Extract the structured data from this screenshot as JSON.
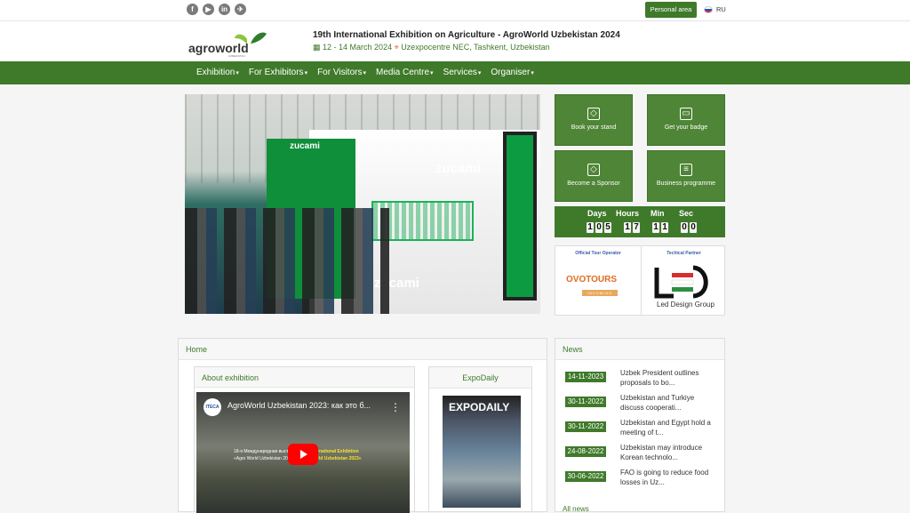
{
  "topbar": {
    "social_icons": [
      "facebook-icon",
      "youtube-icon",
      "linkedin-icon",
      "telegram-icon"
    ],
    "personal_area": "Personal area",
    "language": "RU"
  },
  "logo": {
    "text": "agroworld",
    "sub": "UZBEKISTAN"
  },
  "header": {
    "title": "19th International Exhibition on Agriculture - AgroWorld Uzbekistan 2024",
    "dates": "12 - 14 March 2024",
    "venue": "Uzexpocentre NEC, Tashkent, Uzbekistan"
  },
  "nav": [
    "Exhibition",
    "For Exhibitors",
    "For Visitors",
    "Media Centre",
    "Services",
    "Organiser"
  ],
  "hero": {
    "brand": "zucami",
    "brand_sub": "POULTRY EQUIPMENT"
  },
  "tiles": [
    {
      "label": "Book your stand",
      "icon": "stand-icon"
    },
    {
      "label": "Get your badge",
      "icon": "badge-icon"
    },
    {
      "label": "Become a Sponsor",
      "icon": "sponsor-icon"
    },
    {
      "label": "Business programme",
      "icon": "programme-icon"
    }
  ],
  "countdown": {
    "labels": [
      "Days",
      "Hours",
      "Min",
      "Sec"
    ],
    "days": [
      "1",
      "0",
      "5"
    ],
    "hours": [
      "1",
      "7"
    ],
    "minutes": [
      "1",
      "1"
    ],
    "seconds": [
      "0",
      "0"
    ]
  },
  "partners": [
    {
      "title": "Official Tour Operator",
      "name": "OVOTOURS",
      "sub": "SILK ROAD",
      "tagline": "INCOMING"
    },
    {
      "title": "Techical Partner",
      "name": "Led Design Group",
      "colors": [
        "#d62d2d",
        "#ffffff",
        "#2d8f3e"
      ]
    }
  ],
  "home": {
    "heading": "Home",
    "about": {
      "heading": "About exhibition",
      "video_title": "AgroWorld Uzbekistan 2023: как это б...",
      "caption_left": "18-я Международная выставка",
      "caption_left_2": "«Agro World Uzbekistan 2023»",
      "caption_right": "18th International Exhibition",
      "caption_right_2": "«Agro World Uzbekistan 2023»",
      "channel": "ITECA"
    },
    "expo": {
      "heading": "ExpoDaily",
      "magazine": "EXPODAILY"
    }
  },
  "news": {
    "heading": "News",
    "items": [
      {
        "date": "14-11-2023",
        "text": "Uzbek President outlines proposals to bo..."
      },
      {
        "date": "30-11-2022",
        "text": "Uzbekistan and Turkiye discuss cooperati..."
      },
      {
        "date": "30-11-2022",
        "text": "Uzbekistan and Egypt hold a meeting of t..."
      },
      {
        "date": "24-08-2022",
        "text": "Uzbekistan may introduce Korean technolo..."
      },
      {
        "date": "30-06-2022",
        "text": "FAO is going to reduce food losses in Uz..."
      }
    ],
    "all": "All news"
  }
}
